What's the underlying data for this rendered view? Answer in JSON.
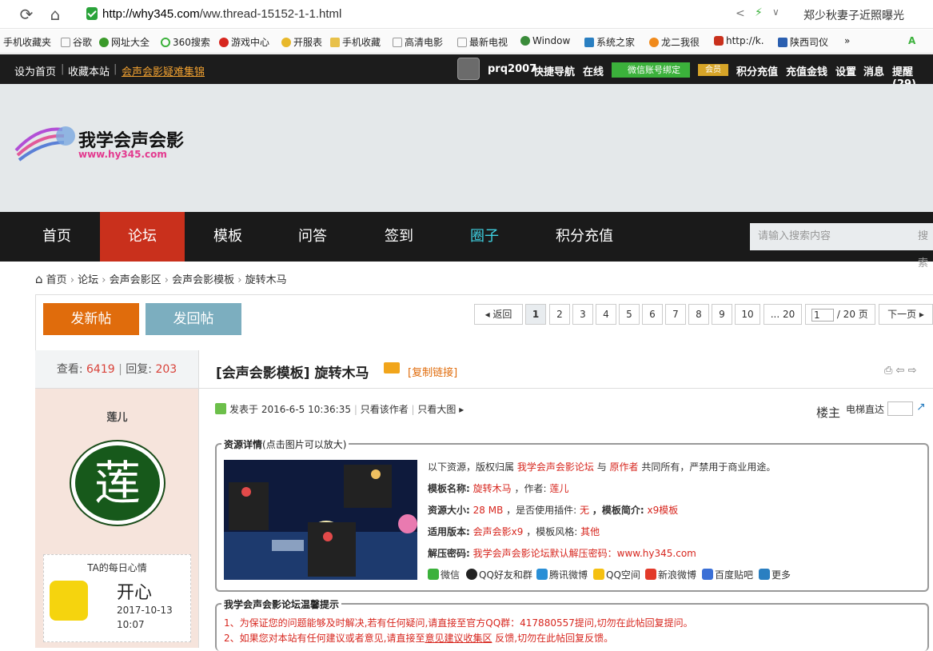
{
  "browser": {
    "url_host": "http://why345.com",
    "url_path": "/ww.thread-15152-1-1.html",
    "news": "郑少秋妻子近照曝光",
    "bookmarks": [
      "手机收藏夹",
      "谷歌",
      "网址大全",
      "360搜索",
      "游戏中心",
      "开服表",
      "手机收藏",
      "高清电影",
      "最新电视",
      "Window",
      "系统之家",
      "龙二我很",
      "http://k.",
      "陕西司仪",
      "»"
    ]
  },
  "topbar": {
    "left": [
      "设为首页",
      "收藏本站"
    ],
    "faq": "会声会影疑难集锦",
    "user": "prq2007",
    "right": [
      "快捷导航",
      "在线"
    ],
    "wx_bind": "微信账号绑定",
    "vip": "会员",
    "right2": [
      "积分充值",
      "充值金钱",
      "设置",
      "消息",
      "提醒(29)"
    ]
  },
  "logo": {
    "name": "我学会声会影",
    "url": "www.hy345.com"
  },
  "nav": {
    "items": [
      "首页",
      "论坛",
      "模板",
      "问答",
      "签到",
      "圈子",
      "积分充值"
    ],
    "search_placeholder": "请输入搜索内容",
    "search_button": "搜索"
  },
  "breadcrumb": [
    "首页",
    "论坛",
    "会声会影区",
    "会声会影模板",
    "旋转木马"
  ],
  "actions": {
    "new_post": "发新帖",
    "reply": "发回帖"
  },
  "pager": {
    "back": "返回",
    "pages": [
      "1",
      "2",
      "3",
      "4",
      "5",
      "6",
      "7",
      "8",
      "9",
      "10",
      "... 20"
    ],
    "current": "1",
    "total": "/ 20 页",
    "next": "下一页"
  },
  "stats": {
    "views_label": "查看:",
    "views": "6419",
    "replies_label": "回复:",
    "replies": "203"
  },
  "thread": {
    "title": "[会声会影模板] 旋转木马",
    "copy_link": "[复制链接]"
  },
  "author": {
    "name": "莲儿",
    "avatar_char": "莲",
    "mood_title": "TA的每日心情",
    "mood": "开心",
    "mood_date": "2017-10-13",
    "mood_time": "10:07"
  },
  "post": {
    "posted": "发表于 2016-6-5 10:36:35",
    "only_author": "只看该作者",
    "only_big": "只看大图",
    "floor": "楼主",
    "elevator": "电梯直达"
  },
  "resource": {
    "legend": "资源详情",
    "legend_note": "(点击图片可以放大)",
    "copyright_a": "以下资源，版权归属",
    "copyright_site": "我学会声会影论坛",
    "copyright_b": "与",
    "copyright_author": "原作者",
    "copyright_c": "共同所有，严禁用于商业用途。",
    "name_label": "模板名称:",
    "name": "旋转木马",
    "author_label": "，作者:",
    "author": "莲儿",
    "size_label": "资源大小:",
    "size": "28 MB",
    "plugin_label": "，是否使用插件:",
    "plugin": "无",
    "intro_label": "，模板简介:",
    "intro": "x9模板",
    "version_label": "适用版本:",
    "version": "会声会影x9",
    "style_label": "，模板风格:",
    "style": "其他",
    "pwd_label": "解压密码:",
    "pwd": "我学会声会影论坛默认解压密码：www.hy345.com",
    "share": [
      "微信",
      "QQ好友和群",
      "腾讯微博",
      "QQ空间",
      "新浪微博",
      "百度贴吧",
      "更多"
    ]
  },
  "tips": {
    "legend": "我学会声会影论坛温馨提示",
    "t1": "1、为保证您的问题能够及时解决,若有任何疑问,请直接至官方QQ群：417880557提问,切勿在此帖回复提问。",
    "t2a": "2、如果您对本站有任何建议或者意见,请直接至",
    "t2b": "意见建议收集区",
    "t2c": "反馈,切勿在此帖回复反馈。"
  },
  "colors": {
    "accent": "#d9433a",
    "nav_active": "#c9301c",
    "new_btn": "#e06c0c",
    "reply_btn": "#7caebf"
  }
}
